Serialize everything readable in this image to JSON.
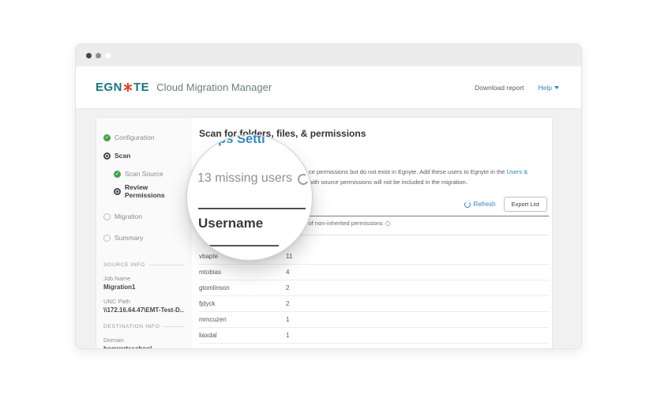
{
  "colors": {
    "brand_teal": "#0f7b80",
    "brand_red": "#e8402a",
    "accent_blue": "#2e86c4",
    "success_green": "#43a047"
  },
  "header": {
    "logo_prefix": "EGN",
    "logo_suffix": "TE",
    "app_title": "Cloud Migration Manager",
    "download_report_label": "Download report",
    "help_label": "Help"
  },
  "sidebar": {
    "steps": [
      {
        "label": "Configuration",
        "state": "done"
      },
      {
        "label": "Scan",
        "state": "active"
      },
      {
        "label": "Scan Source",
        "state": "done"
      },
      {
        "label": "Review Permissions",
        "state": "active"
      },
      {
        "label": "Migration",
        "state": "todo"
      },
      {
        "label": "Summary",
        "state": "todo"
      }
    ],
    "source_info_label": "SOURCE INFO",
    "job_name_label": "Job Name",
    "job_name_value": "Migration1",
    "unc_path_label": "UNC Path",
    "unc_path_value": "\\\\172.16.64.47\\EMT-Test-D...",
    "destination_info_label": "DESTINATION INFO",
    "domain_label": "Domain",
    "domain_value": "hogwartsschool"
  },
  "main": {
    "heading": "Scan for folders, files, & permissions",
    "paragraph_line1_visible": "ce permissions but do not exist in Egnyte. Add these users to Egnyte in the ",
    "paragraph_link": "Users &",
    "paragraph_line2_visible": "with source permissions will not be included in the migration.",
    "refresh_label": "Refresh",
    "export_label": "Export List",
    "col2_header_visible": "r of non-inherited permissions",
    "rows": [
      [
        "vbapte",
        "11"
      ],
      [
        "mtobias",
        "4"
      ],
      [
        "gtomlinson",
        "2"
      ],
      [
        "fjdyck",
        "2"
      ],
      [
        "mmcuzen",
        "1"
      ],
      [
        "liaxdal",
        "1"
      ]
    ]
  },
  "magnifier": {
    "link_fragment": "oups Setti",
    "missing_users": "13 missing users",
    "username_header": "Username"
  }
}
